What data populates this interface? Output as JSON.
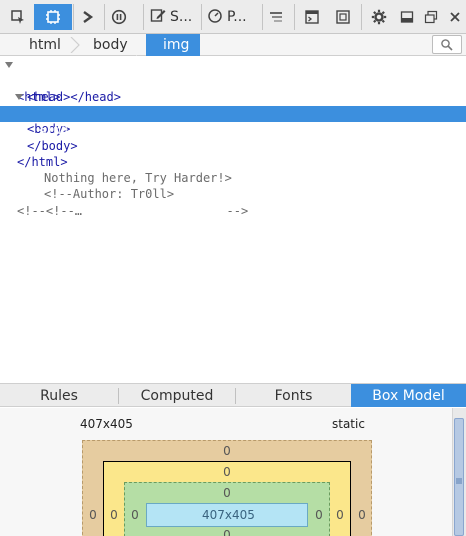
{
  "toolbar": {
    "style_label": "S...",
    "perf_label": "P...",
    "active_color": "#3c8fde"
  },
  "breadcrumb": [
    "html",
    "body",
    "img"
  ],
  "markup": {
    "lines": [
      {
        "text": "<html>"
      },
      {
        "text": "<head></head>"
      },
      {
        "text": "<body>"
      },
      {
        "text": "<img src=\"tr0ll_again.jpg\"></img>"
      },
      {
        "text": "</body>"
      },
      {
        "text": "</html>"
      },
      {
        "text": "Nothing here, Try Harder!>"
      },
      {
        "text": "<!--Author: Tr0ll>"
      },
      {
        "text": "<!--<!--…                    -->"
      }
    ]
  },
  "tabs": [
    "Rules",
    "Computed",
    "Fonts",
    "Box Model"
  ],
  "box_model": {
    "dimensions": "407x405",
    "position": "static",
    "margin_top": "0",
    "border_top": "0",
    "padding_top": "0",
    "content": "407x405",
    "margin_left": "0",
    "border_left": "0",
    "padding_left": "0",
    "padding_right": "0",
    "border_right": "0",
    "margin_right": "0",
    "padding_bottom": "0"
  }
}
